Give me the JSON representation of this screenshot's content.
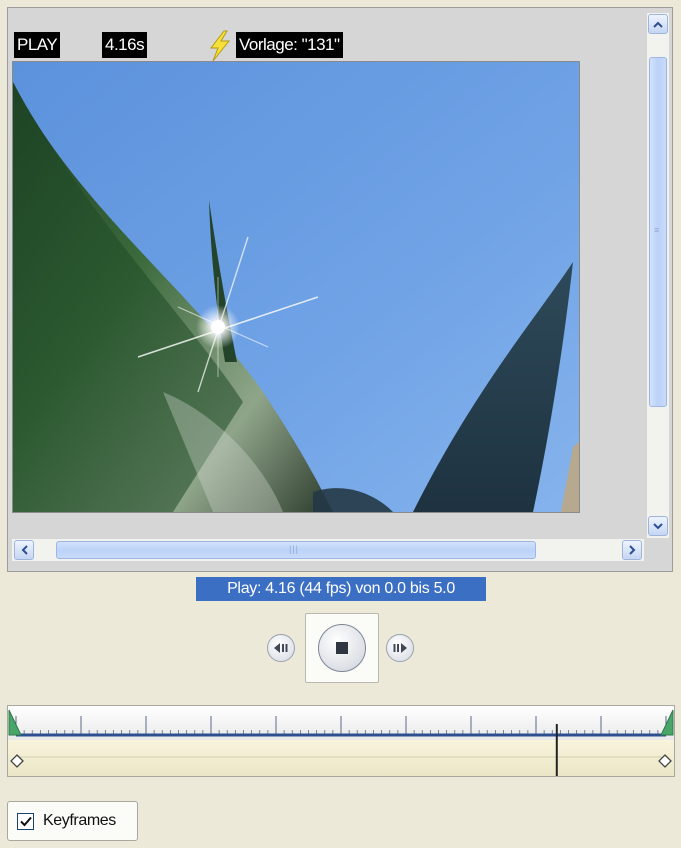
{
  "overlay": {
    "mode": "PLAY",
    "time": "4.16s",
    "template": "Vorlage: \"131\""
  },
  "icons": {
    "template": "lightning-bolt-icon",
    "step_back": "step-back-icon",
    "stop": "stop-icon",
    "step_forward": "step-forward-icon",
    "scroll_up": "chevron-up-icon",
    "scroll_down": "chevron-down-icon",
    "scroll_left": "chevron-left-icon",
    "scroll_right": "chevron-right-icon",
    "checkbox": "checkmark-icon"
  },
  "status": "Play: 4.16 (44 fps) von 0.0 bis 5.0",
  "playback": {
    "position": 4.16,
    "start": 0.0,
    "end": 5.0
  },
  "keyframes": {
    "label": "Keyframes",
    "checked": true
  },
  "colors": {
    "status_bg": "#3b6fc4",
    "sky": "#6ea0e0",
    "timeline_line": "#2d4f8f",
    "marker_green": "#3e9a5a"
  }
}
